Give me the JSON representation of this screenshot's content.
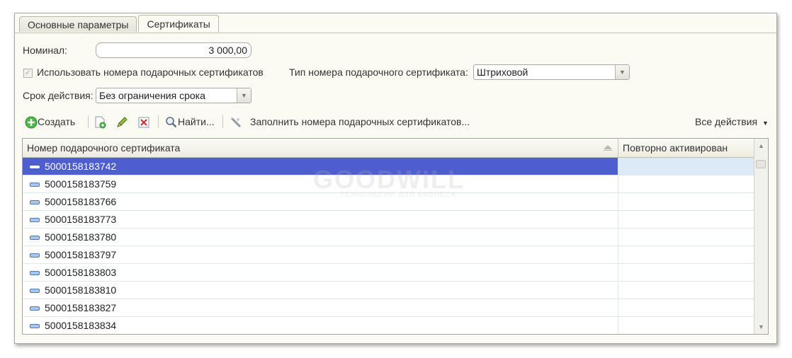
{
  "tabs": [
    {
      "label": "Основные параметры",
      "active": false
    },
    {
      "label": "Сертификаты",
      "active": true
    }
  ],
  "form": {
    "nominal_label": "Номинал:",
    "nominal_value": "3 000,00",
    "use_numbers_label": "Использовать номера подарочных сертификатов",
    "use_numbers_checked": true,
    "cert_type_label": "Тип номера подарочного сертификата:",
    "cert_type_value": "Штриховой",
    "validity_label": "Срок действия:",
    "validity_value": "Без ограничения срока"
  },
  "toolbar": {
    "create_label": "Создать",
    "find_label": "Найти...",
    "fill_label": "Заполнить номера подарочных сертификатов...",
    "all_actions_label": "Все действия"
  },
  "table": {
    "columns": [
      "Номер подарочного сертификата",
      "Повторно активирован"
    ],
    "rows": [
      {
        "number": "5000158183742",
        "reactivated": "",
        "selected": true
      },
      {
        "number": "5000158183759",
        "reactivated": ""
      },
      {
        "number": "5000158183766",
        "reactivated": ""
      },
      {
        "number": "5000158183773",
        "reactivated": ""
      },
      {
        "number": "5000158183780",
        "reactivated": ""
      },
      {
        "number": "5000158183797",
        "reactivated": ""
      },
      {
        "number": "5000158183803",
        "reactivated": ""
      },
      {
        "number": "5000158183810",
        "reactivated": ""
      },
      {
        "number": "5000158183827",
        "reactivated": ""
      },
      {
        "number": "5000158183834",
        "reactivated": ""
      }
    ]
  },
  "watermark": {
    "title": "GOODWILL",
    "subtitle": "ТЕХНОЛОГИИ ДЛЯ БИЗНЕСА"
  },
  "colors": {
    "selection": "#4e5dd0",
    "panel": "#fbfbf4",
    "accent_green": "#3aa83a"
  }
}
